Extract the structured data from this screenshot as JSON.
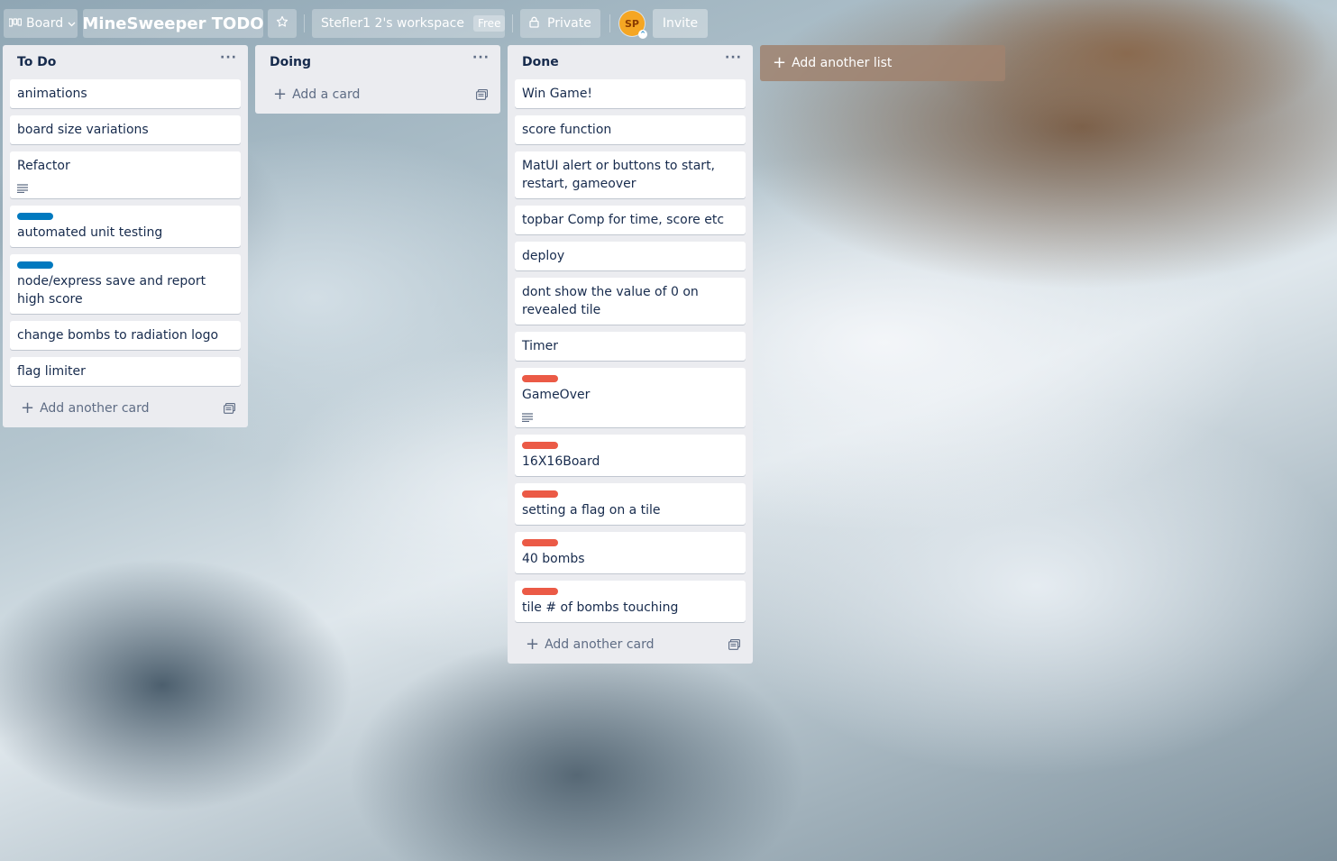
{
  "header": {
    "view_label": "Board",
    "board_title": "MineSweeper TODO",
    "workspace_label": "Stefler1 2's workspace",
    "workspace_badge": "Free",
    "visibility_label": "Private",
    "avatar_initials": "SP",
    "invite_label": "Invite"
  },
  "colors": {
    "blue_label": "#0079bf",
    "red_label": "#eb5a46"
  },
  "lists": [
    {
      "title": "To Do",
      "menu": "···",
      "add_card_label": "Add another card",
      "cards": [
        {
          "text": "animations"
        },
        {
          "text": "board size variations"
        },
        {
          "text": "Refactor",
          "has_description": true
        },
        {
          "text": "automated unit testing",
          "label_color": "#0079bf"
        },
        {
          "text": "node/express save and report high score",
          "label_color": "#0079bf"
        },
        {
          "text": "change bombs to radiation logo"
        },
        {
          "text": "flag limiter"
        }
      ]
    },
    {
      "title": "Doing",
      "menu": "···",
      "add_card_label": "Add a card",
      "cards": []
    },
    {
      "title": "Done",
      "menu": "···",
      "add_card_label": "Add another card",
      "cards": [
        {
          "text": "Win Game!"
        },
        {
          "text": "score function"
        },
        {
          "text": "MatUI alert or buttons to start, restart, gameover"
        },
        {
          "text": "topbar Comp for time, score etc"
        },
        {
          "text": "deploy"
        },
        {
          "text": "dont show the value of 0 on revealed tile"
        },
        {
          "text": "Timer"
        },
        {
          "text": "GameOver",
          "label_color": "#eb5a46",
          "has_description": true
        },
        {
          "text": "16X16Board",
          "label_color": "#eb5a46"
        },
        {
          "text": "setting a flag on a tile",
          "label_color": "#eb5a46"
        },
        {
          "text": "40 bombs",
          "label_color": "#eb5a46"
        },
        {
          "text": "tile # of bombs touching",
          "label_color": "#eb5a46"
        }
      ]
    }
  ],
  "add_list_label": "Add another list"
}
